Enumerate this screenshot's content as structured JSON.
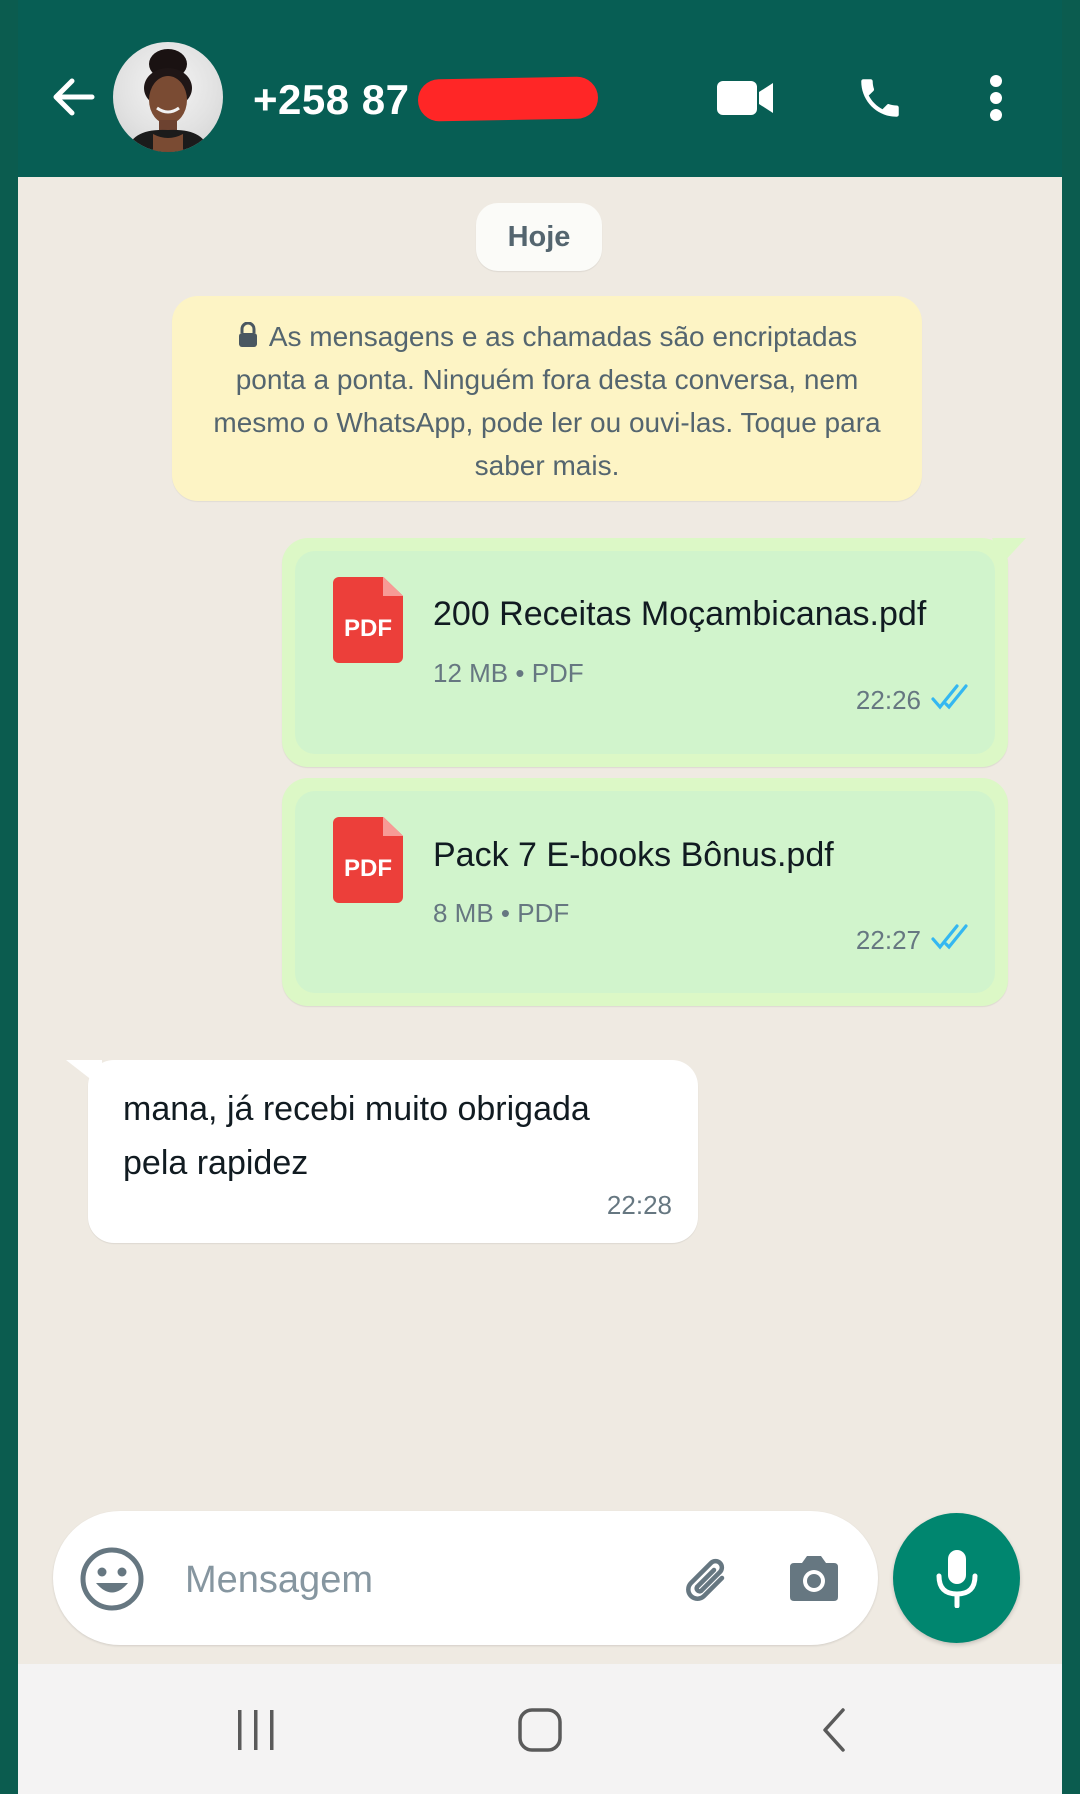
{
  "header": {
    "contact_title": "+258 87",
    "colors": {
      "header_bg": "#075e54",
      "accent": "#00866f",
      "redaction": "#ff2626"
    },
    "icons": [
      "back-arrow-icon",
      "video-call-icon",
      "voice-call-icon",
      "more-options-icon"
    ]
  },
  "chat": {
    "date_chip": "Hoje",
    "encryption_notice": "As mensagens e as chamadas são encriptadas ponta a ponta. Ninguém fora desta conversa, nem mesmo o WhatsApp, pode ler ou ouvi-las. Toque para saber mais.",
    "messages": [
      {
        "direction": "outgoing",
        "type": "document",
        "icon_label": "PDF",
        "file_name": "200 Receitas Moçambicanas.pdf",
        "file_meta": "12 MB • PDF",
        "time": "22:26",
        "status": "read"
      },
      {
        "direction": "outgoing",
        "type": "document",
        "icon_label": "PDF",
        "file_name": "Pack 7 E-books Bônus.pdf",
        "file_meta": "8 MB • PDF",
        "time": "22:27",
        "status": "read"
      },
      {
        "direction": "incoming",
        "type": "text",
        "text": "mana, já recebi muito obrigada pela rapidez",
        "time": "22:28"
      }
    ]
  },
  "composer": {
    "placeholder": "Mensagem",
    "value": "",
    "icons": [
      "emoji-icon",
      "attach-icon",
      "camera-icon",
      "mic-icon"
    ]
  },
  "navbar": {
    "icons": [
      "recents-icon",
      "home-icon",
      "back-icon"
    ]
  }
}
